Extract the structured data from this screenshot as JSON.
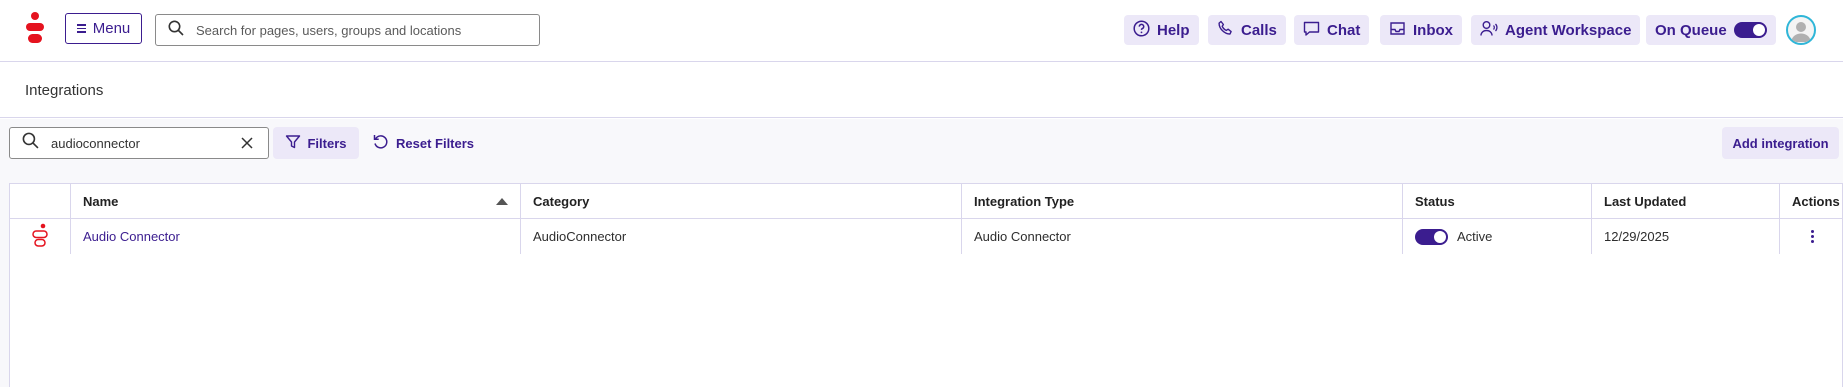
{
  "topbar": {
    "menu_label": "Menu",
    "search_placeholder": "Search for pages, users, groups and locations",
    "nav": {
      "help": "Help",
      "calls": "Calls",
      "chat": "Chat",
      "inbox": "Inbox",
      "agent_workspace": "Agent Workspace",
      "on_queue": "On Queue"
    },
    "on_queue_enabled": true
  },
  "page": {
    "title": "Integrations"
  },
  "toolbar": {
    "search_value": "audioconnector",
    "filters_label": "Filters",
    "reset_label": "Reset Filters",
    "add_label": "Add integration"
  },
  "table": {
    "columns": {
      "name": "Name",
      "category": "Category",
      "integration_type": "Integration Type",
      "status": "Status",
      "last_updated": "Last Updated",
      "actions": "Actions"
    },
    "sort": {
      "column": "Name",
      "direction": "ascending"
    },
    "rows": [
      {
        "icon": "genesys-logo-icon",
        "name": "Audio Connector",
        "category": "AudioConnector",
        "integration_type": "Audio Connector",
        "status": "Active",
        "status_enabled": true,
        "last_updated": "12/29/2025"
      }
    ]
  },
  "colors": {
    "brand_red": "#e5131f",
    "accent_purple": "#3b1d8f",
    "button_tint": "#ece8f8",
    "avatar_ring": "#2fb6d8"
  }
}
